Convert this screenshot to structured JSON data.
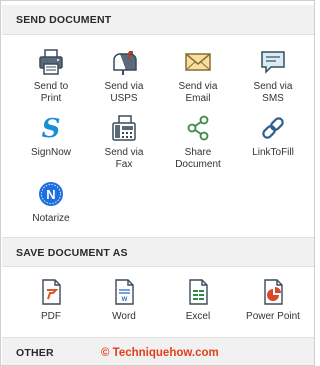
{
  "sections": {
    "send": {
      "title": "SEND DOCUMENT",
      "items": [
        {
          "l1": "Send to",
          "l2": "Print",
          "icon": "printer-icon"
        },
        {
          "l1": "Send via",
          "l2": "USPS",
          "icon": "mailbox-icon"
        },
        {
          "l1": "Send via",
          "l2": "Email",
          "icon": "envelope-icon"
        },
        {
          "l1": "Send via",
          "l2": "SMS",
          "icon": "sms-icon"
        },
        {
          "l1": "SignNow",
          "l2": "",
          "icon": "signnow-icon"
        },
        {
          "l1": "Send via",
          "l2": "Fax",
          "icon": "fax-icon"
        },
        {
          "l1": "Share",
          "l2": "Document",
          "icon": "share-icon"
        },
        {
          "l1": "LinkToFill",
          "l2": "",
          "icon": "link-icon"
        },
        {
          "l1": "Notarize",
          "l2": "",
          "icon": "notarize-icon"
        }
      ]
    },
    "save": {
      "title": "SAVE DOCUMENT AS",
      "items": [
        {
          "l1": "PDF",
          "icon": "pdf-file-icon"
        },
        {
          "l1": "Word",
          "icon": "word-file-icon"
        },
        {
          "l1": "Excel",
          "icon": "excel-file-icon"
        },
        {
          "l1": "Power Point",
          "icon": "powerpoint-file-icon"
        }
      ]
    },
    "other": {
      "title": "OTHER"
    }
  },
  "watermark": "© Techniquehow.com",
  "colors": {
    "icon_dark": "#3a4a5a",
    "envelope_fill": "#f7dfa3",
    "envelope_stroke": "#8a6d2f",
    "sms_fill": "#d8ecf6",
    "signnow_blue": "#1a8fd6",
    "share_green": "#3c8a4a",
    "link_blue": "#2f5f8f",
    "notarize_blue": "#1f6fe0",
    "pdf_red": "#e0542a",
    "word_blue": "#2e6ec2",
    "excel_green": "#2f8a45",
    "ppt_red": "#d9482b",
    "watermark_red": "#e0401a"
  }
}
